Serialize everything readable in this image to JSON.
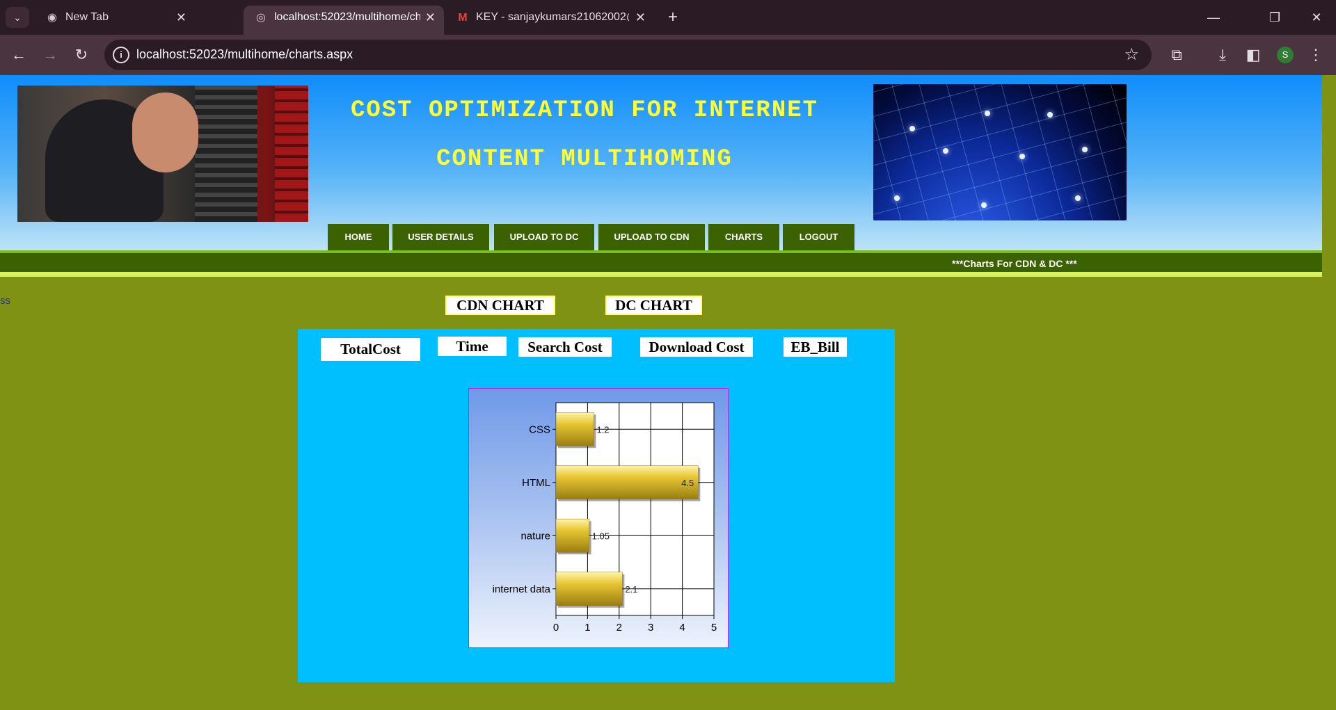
{
  "browser": {
    "tabs": [
      {
        "title": "New Tab",
        "icon": "chrome-icon",
        "active": false
      },
      {
        "title": "localhost:52023/multihome/cha",
        "icon": "globe-icon",
        "active": true
      },
      {
        "title": "KEY - sanjaykumars21062002@",
        "icon": "gmail-icon",
        "active": false
      }
    ],
    "url": "localhost:52023/multihome/charts.aspx",
    "profile_initial": "S",
    "new_tab_symbol": "+",
    "close_symbol": "✕"
  },
  "header": {
    "title_line1": "COST OPTIMIZATION FOR INTERNET",
    "title_line2": "CONTENT MULTIHOMING",
    "title_color": "#ffff33"
  },
  "nav": {
    "items": [
      "HOME",
      "USER DETAILS",
      "UPLOAD TO DC",
      "UPLOAD TO CDN",
      "CHARTS",
      "LOGOUT"
    ],
    "bg_color": "#3b6201"
  },
  "marquee": "***Charts For CDN & DC ***",
  "stray_text": "ss",
  "chart_links": [
    "CDN CHART",
    "DC CHART"
  ],
  "metric_buttons": [
    "TotalCost",
    "Time",
    "Search Cost",
    "Download Cost",
    "EB_Bill"
  ],
  "colors": {
    "page_bg": "#7f9214",
    "panel_bg": "#00bfff",
    "bar_fill": "#e6c531"
  },
  "chart_data": {
    "type": "bar",
    "orientation": "horizontal",
    "categories": [
      "CSS",
      "HTML",
      "nature",
      "internet data"
    ],
    "values": [
      1.2,
      4.5,
      1.05,
      2.1
    ],
    "value_labels": [
      "1.2",
      "4.5",
      "1.05",
      "2.1"
    ],
    "xlim": [
      0,
      5
    ],
    "x_ticks": [
      "0",
      "1",
      "2",
      "3",
      "4",
      "5"
    ],
    "title": "",
    "xlabel": "",
    "ylabel": "",
    "grid": true
  }
}
